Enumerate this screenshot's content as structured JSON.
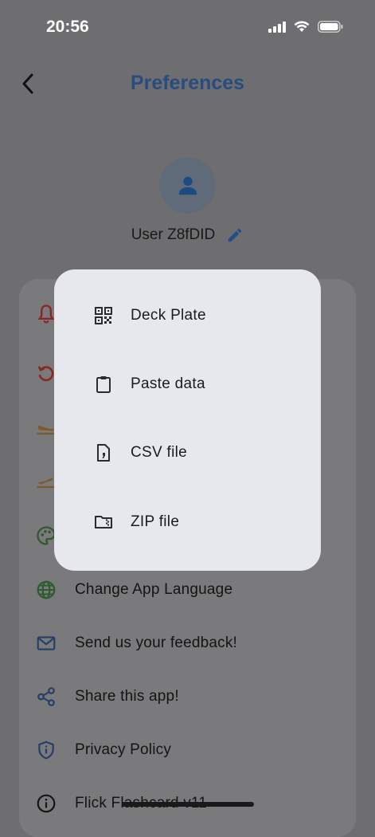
{
  "status": {
    "time": "20:56"
  },
  "header": {
    "title": "Preferences"
  },
  "profile": {
    "username": "User Z8fDID"
  },
  "settings": {
    "items": [
      {
        "label": "Change App Language",
        "icon": "globe-icon"
      },
      {
        "label": "Send us your feedback!",
        "icon": "mail-icon"
      },
      {
        "label": "Share this app!",
        "icon": "share-icon"
      },
      {
        "label": "Privacy Policy",
        "icon": "shield-icon"
      },
      {
        "label": "Flick Flashcard v11",
        "icon": "info-icon"
      }
    ]
  },
  "import_menu": {
    "items": [
      {
        "label": "Deck Plate",
        "icon": "qr-code-icon"
      },
      {
        "label": "Paste data",
        "icon": "clipboard-icon"
      },
      {
        "label": "CSV file",
        "icon": "csv-file-icon"
      },
      {
        "label": "ZIP file",
        "icon": "zip-folder-icon"
      }
    ]
  },
  "colors": {
    "title": "#264d7e",
    "overlay": "#6e6e70",
    "popup": "#e7e8ee"
  }
}
